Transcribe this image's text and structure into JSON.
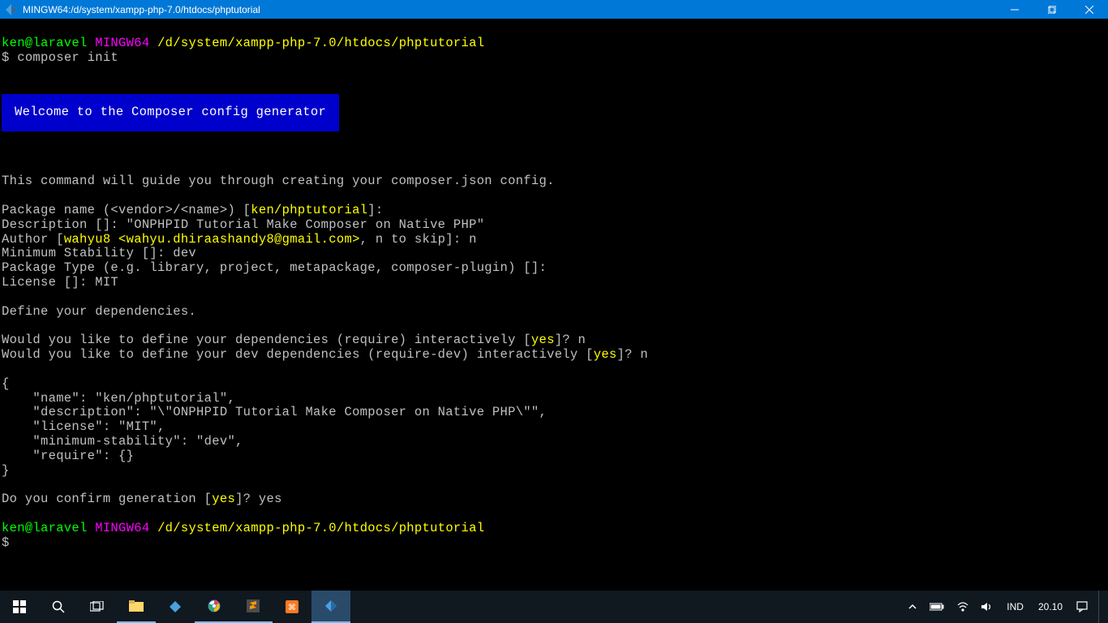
{
  "titlebar": {
    "title": "MINGW64:/d/system/xampp-php-7.0/htdocs/phptutorial"
  },
  "terminal": {
    "prompt_user": "ken@laravel",
    "prompt_shell": "MINGW64",
    "prompt_path": "/d/system/xampp-php-7.0/htdocs/phptutorial",
    "command": "composer init",
    "banner": "Welcome to the Composer config generator",
    "intro": "This command will guide you through creating your composer.json config.",
    "pkg_label": "Package name (<vendor>/<name>) [",
    "pkg_default": "ken/phptutorial",
    "pkg_after": "]:",
    "desc_line": "Description []: \"ONPHPID Tutorial Make Composer on Native PHP\"",
    "author_pre": "Author [",
    "author_val": "wahyu8 <wahyu.dhiraashandy8@gmail.com>",
    "author_post": ", n to skip]: n",
    "minstab": "Minimum Stability []: dev",
    "pkgtype": "Package Type (e.g. library, project, metapackage, composer-plugin) []:",
    "license": "License []: MIT",
    "define_deps": "Define your dependencies.",
    "req_pre": "Would you like to define your dependencies (require) interactively [",
    "req_yes": "yes",
    "req_post": "]? n",
    "reqdev_pre": "Would you like to define your dev dependencies (require-dev) interactively [",
    "reqdev_yes": "yes",
    "reqdev_post": "]? n",
    "json_l1": "{",
    "json_l2": "    \"name\": \"ken/phptutorial\",",
    "json_l3": "    \"description\": \"\\\"ONPHPID Tutorial Make Composer on Native PHP\\\"\",",
    "json_l4": "    \"license\": \"MIT\",",
    "json_l5": "    \"minimum-stability\": \"dev\",",
    "json_l6": "    \"require\": {}",
    "json_l7": "}",
    "confirm_pre": "Do you confirm generation [",
    "confirm_yes": "yes",
    "confirm_post": "]? yes",
    "dollar": "$"
  },
  "taskbar": {
    "lang": "IND",
    "time": "20.10"
  }
}
